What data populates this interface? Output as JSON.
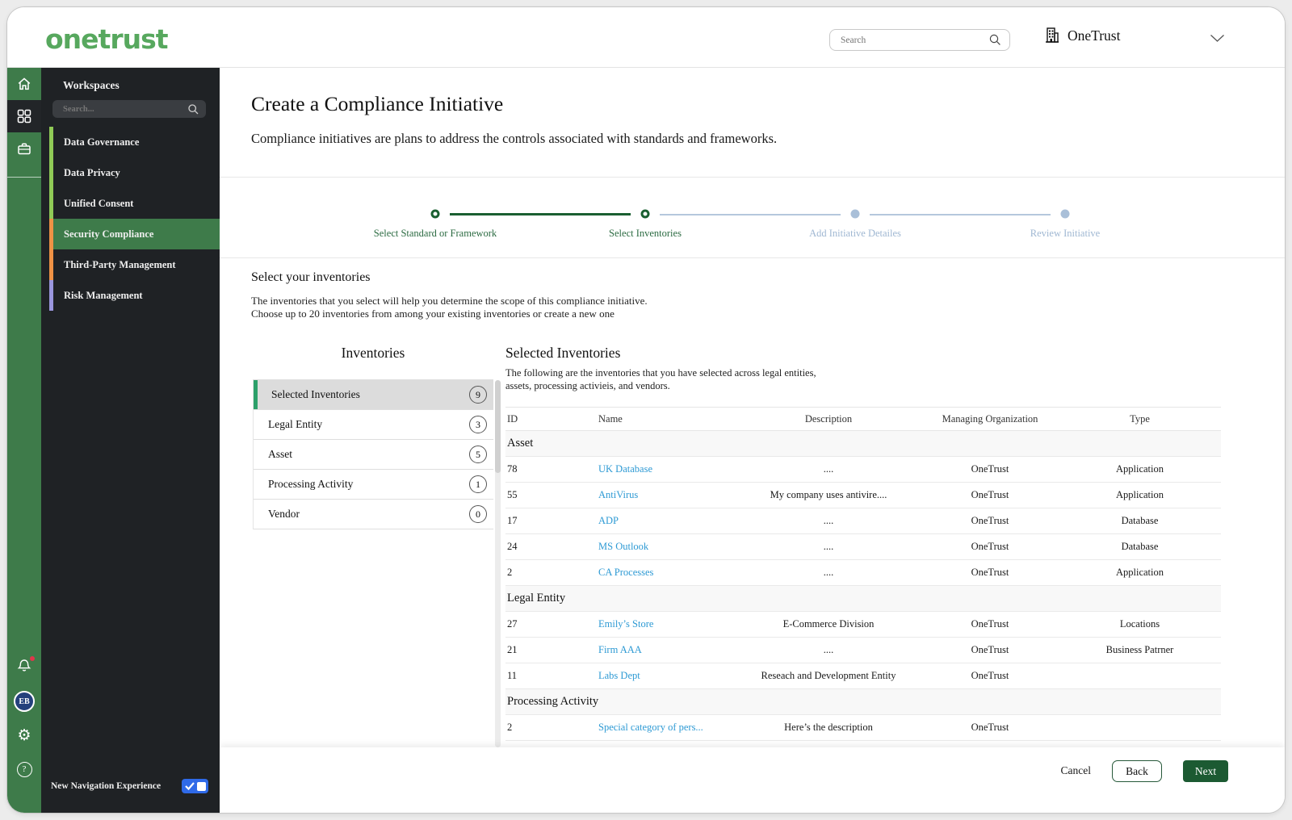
{
  "topbar": {
    "logo_text": "onetrust",
    "search_placeholder": "Search",
    "org_label": "OneTrust"
  },
  "rail": {
    "avatar_initials": "EB"
  },
  "sidebar": {
    "title": "Workspaces",
    "search_placeholder": "Search...",
    "items": [
      {
        "label": "Data Governance",
        "accent": "#8fca56",
        "active": false
      },
      {
        "label": "Data Privacy",
        "accent": "#8fca56",
        "active": false
      },
      {
        "label": "Unified Consent",
        "accent": "#8fca56",
        "active": false
      },
      {
        "label": "Security Compliance",
        "accent": "#ef9245",
        "active": true
      },
      {
        "label": "Third-Party Management",
        "accent": "#ef9245",
        "active": false
      },
      {
        "label": "Risk Management",
        "accent": "#9a96de",
        "active": false
      }
    ],
    "footer_label": "New Navigation Experience",
    "toggle_on": true
  },
  "wizard": {
    "title": "Create a Compliance Initiative",
    "subtitle": "Compliance initiatives are plans to address the controls associated with standards and frameworks.",
    "steps": [
      {
        "label": "Select Standard or Framework",
        "state": "done"
      },
      {
        "label": "Select Inventories",
        "state": "current"
      },
      {
        "label": "Add Initiative Detailes",
        "state": "upcoming"
      },
      {
        "label": "Review Initiative",
        "state": "upcoming"
      }
    ]
  },
  "intro": {
    "heading": "Select your inventories",
    "line1": "The inventories that you select will help you determine the scope of this compliance initiative.",
    "line2": "Choose up to 20 inventories from among your existing inventories or create a new one"
  },
  "inventories": {
    "title": "Inventories",
    "items": [
      {
        "label": "Selected Inventories",
        "count": "9",
        "active": true
      },
      {
        "label": "Legal Entity",
        "count": "3",
        "active": false
      },
      {
        "label": "Asset",
        "count": "5",
        "active": false
      },
      {
        "label": "Processing Activity",
        "count": "1",
        "active": false
      },
      {
        "label": "Vendor",
        "count": "0",
        "active": false
      }
    ]
  },
  "selected_panel": {
    "title": "Selected Inventories",
    "description_line1": "The following are the inventories that you have selected across legal entities,",
    "description_line2": "assets, processing activieis, and vendors.",
    "columns": [
      "ID",
      "Name",
      "Description",
      "Managing Organization",
      "Type"
    ],
    "groups": [
      {
        "name": "Asset",
        "rows": [
          [
            "78",
            "UK Database",
            "....",
            "OneTrust",
            "Application"
          ],
          [
            "55",
            "AntiVirus",
            "My company uses antivire....",
            "OneTrust",
            "Application"
          ],
          [
            "17",
            "ADP",
            "....",
            "OneTrust",
            "Database"
          ],
          [
            "24",
            "MS Outlook",
            "....",
            "OneTrust",
            "Database"
          ],
          [
            "2",
            "CA Processes",
            "....",
            "OneTrust",
            "Application"
          ]
        ]
      },
      {
        "name": "Legal Entity",
        "rows": [
          [
            "27",
            "Emily’s Store",
            "E-Commerce Division",
            "OneTrust",
            "Locations"
          ],
          [
            "21",
            "Firm AAA",
            "....",
            "OneTrust",
            "Business Patrner"
          ],
          [
            "11",
            "Labs Dept",
            "Reseach and Development Entity",
            "OneTrust",
            ""
          ]
        ]
      },
      {
        "name": "Processing Activity",
        "rows": [
          [
            "2",
            "Special category of pers...",
            "Here’s the description",
            "OneTrust",
            ""
          ]
        ]
      }
    ]
  },
  "footer": {
    "cancel_label": "Cancel",
    "back_label": "Back",
    "next_label": "Next"
  },
  "colors": {
    "brand_green": "#57a85e",
    "rail_green": "#3e7b4a",
    "sidebar_dark": "#1f2225",
    "workspace_selected": "#3e7b4a",
    "stepper_active": "#1a5f31",
    "stepper_inactive": "#a9bfd8",
    "link_blue": "#2e9ad4",
    "primary_button": "#1c5a32",
    "toggle_blue": "#2f6ae8",
    "notification_red": "#e0364b"
  }
}
